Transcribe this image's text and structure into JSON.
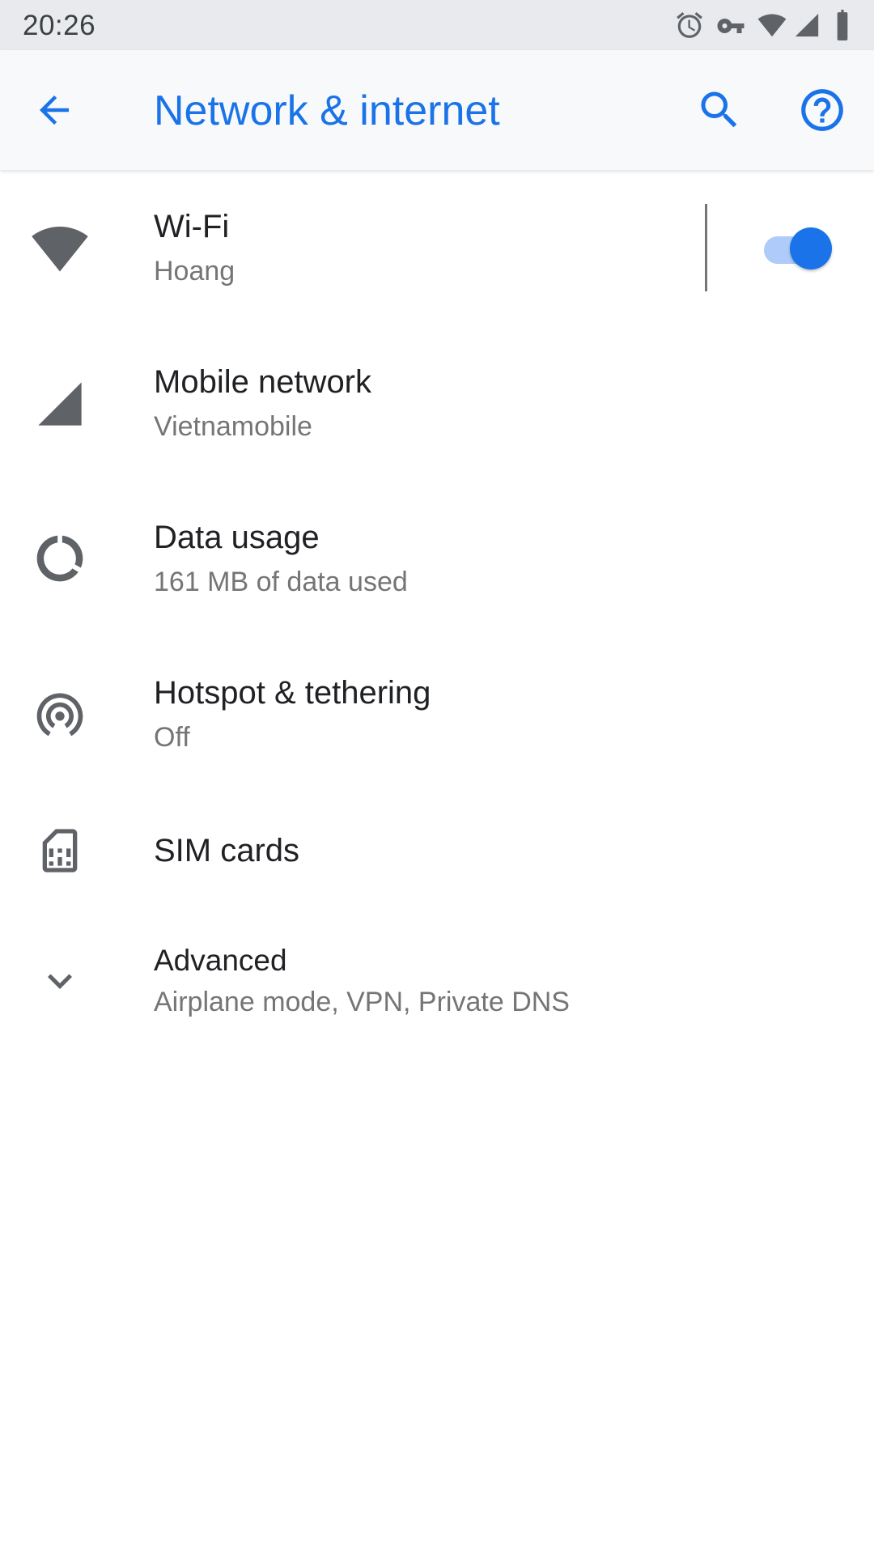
{
  "status_bar": {
    "time": "20:26",
    "icons": [
      "alarm-icon",
      "vpn-key-icon",
      "wifi-signal-icon",
      "cell-signal-icon",
      "battery-icon"
    ]
  },
  "app_bar": {
    "title": "Network & internet",
    "back_icon": "arrow-back-icon",
    "search_icon": "search-icon",
    "help_icon": "help-icon",
    "accent_color": "#1a73e8"
  },
  "items": [
    {
      "title": "Wi-Fi",
      "summary": "Hoang",
      "icon": "wifi-icon",
      "toggle_on": true
    },
    {
      "title": "Mobile network",
      "summary": "Vietnamobile",
      "icon": "cell-signal-icon"
    },
    {
      "title": "Data usage",
      "summary": "161 MB of data used",
      "icon": "data-usage-icon"
    },
    {
      "title": "Hotspot & tethering",
      "summary": "Off",
      "icon": "hotspot-icon"
    },
    {
      "title": "SIM cards",
      "icon": "sim-card-icon"
    },
    {
      "title": "Advanced",
      "summary": "Airplane mode, VPN, Private DNS",
      "icon": "chevron-down-icon"
    }
  ]
}
